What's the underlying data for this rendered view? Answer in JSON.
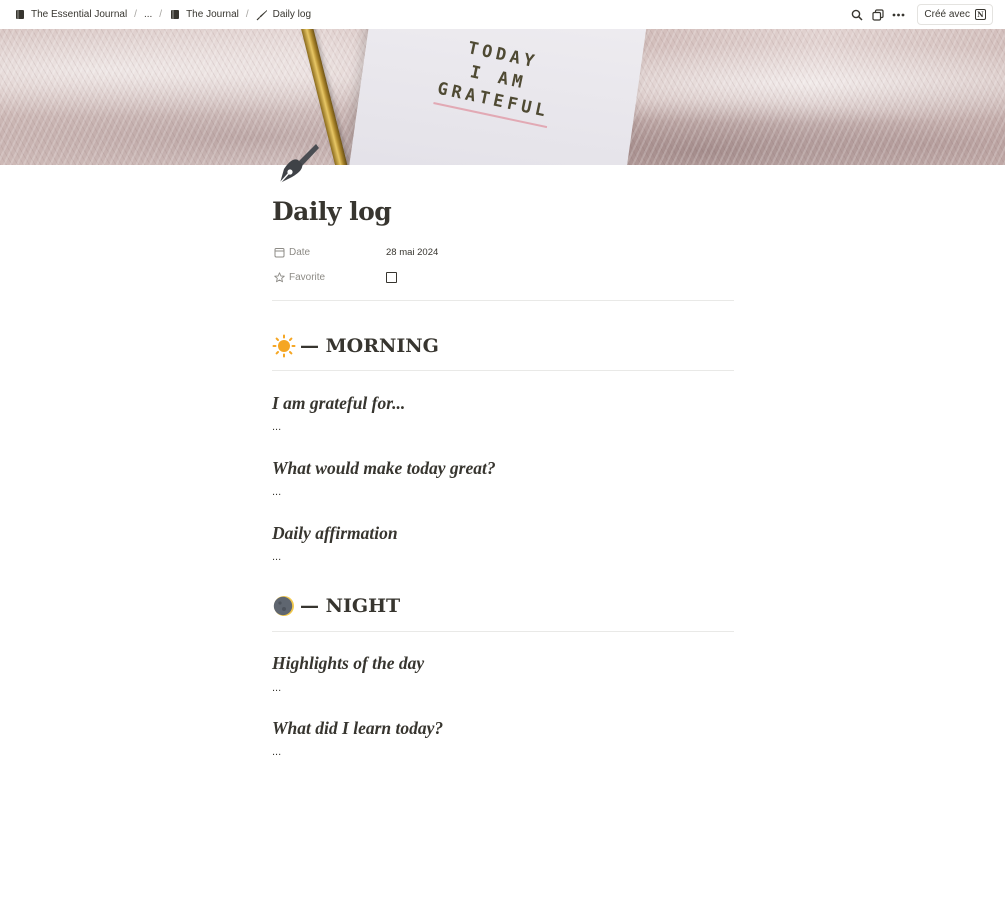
{
  "breadcrumb": {
    "items": [
      {
        "label": "The Essential Journal",
        "icon": "book-icon"
      },
      {
        "label": "...",
        "icon": null
      },
      {
        "label": "The Journal",
        "icon": "book-icon"
      },
      {
        "label": "Daily log",
        "icon": "fountain-pen-icon"
      }
    ],
    "separator": "/"
  },
  "topbar": {
    "actions": [
      "search-icon",
      "duplicate-icon",
      "more-icon"
    ],
    "made_with_label": "Créé avec",
    "made_with_logo": "N"
  },
  "cover": {
    "notebook_lines": [
      "TODAY",
      "I AM",
      "GRATEFUL"
    ]
  },
  "page": {
    "icon": "fountain-pen-icon",
    "title": "Daily log",
    "properties": [
      {
        "label": "Date",
        "icon": "calendar-icon",
        "value": "28 mai 2024"
      },
      {
        "label": "Favorite",
        "icon": "star-icon",
        "checked": false
      }
    ],
    "sections": [
      {
        "emoji": "sun-icon",
        "heading": "— MORNING",
        "blocks": [
          {
            "heading": "I am grateful for...",
            "text": "..."
          },
          {
            "heading": "What would make today great?",
            "text": "..."
          },
          {
            "heading": "Daily affirmation",
            "text": "..."
          }
        ]
      },
      {
        "emoji": "moon-icon",
        "heading": "— NIGHT",
        "blocks": [
          {
            "heading": "Highlights of the day",
            "text": "..."
          },
          {
            "heading": "What did I learn today?",
            "text": "..."
          }
        ]
      }
    ]
  },
  "colors": {
    "text": "#37352f",
    "muted": "#8d8b86",
    "divider": "#e9e9e7",
    "sun": "#f5a623",
    "moon": "#5f6670"
  }
}
